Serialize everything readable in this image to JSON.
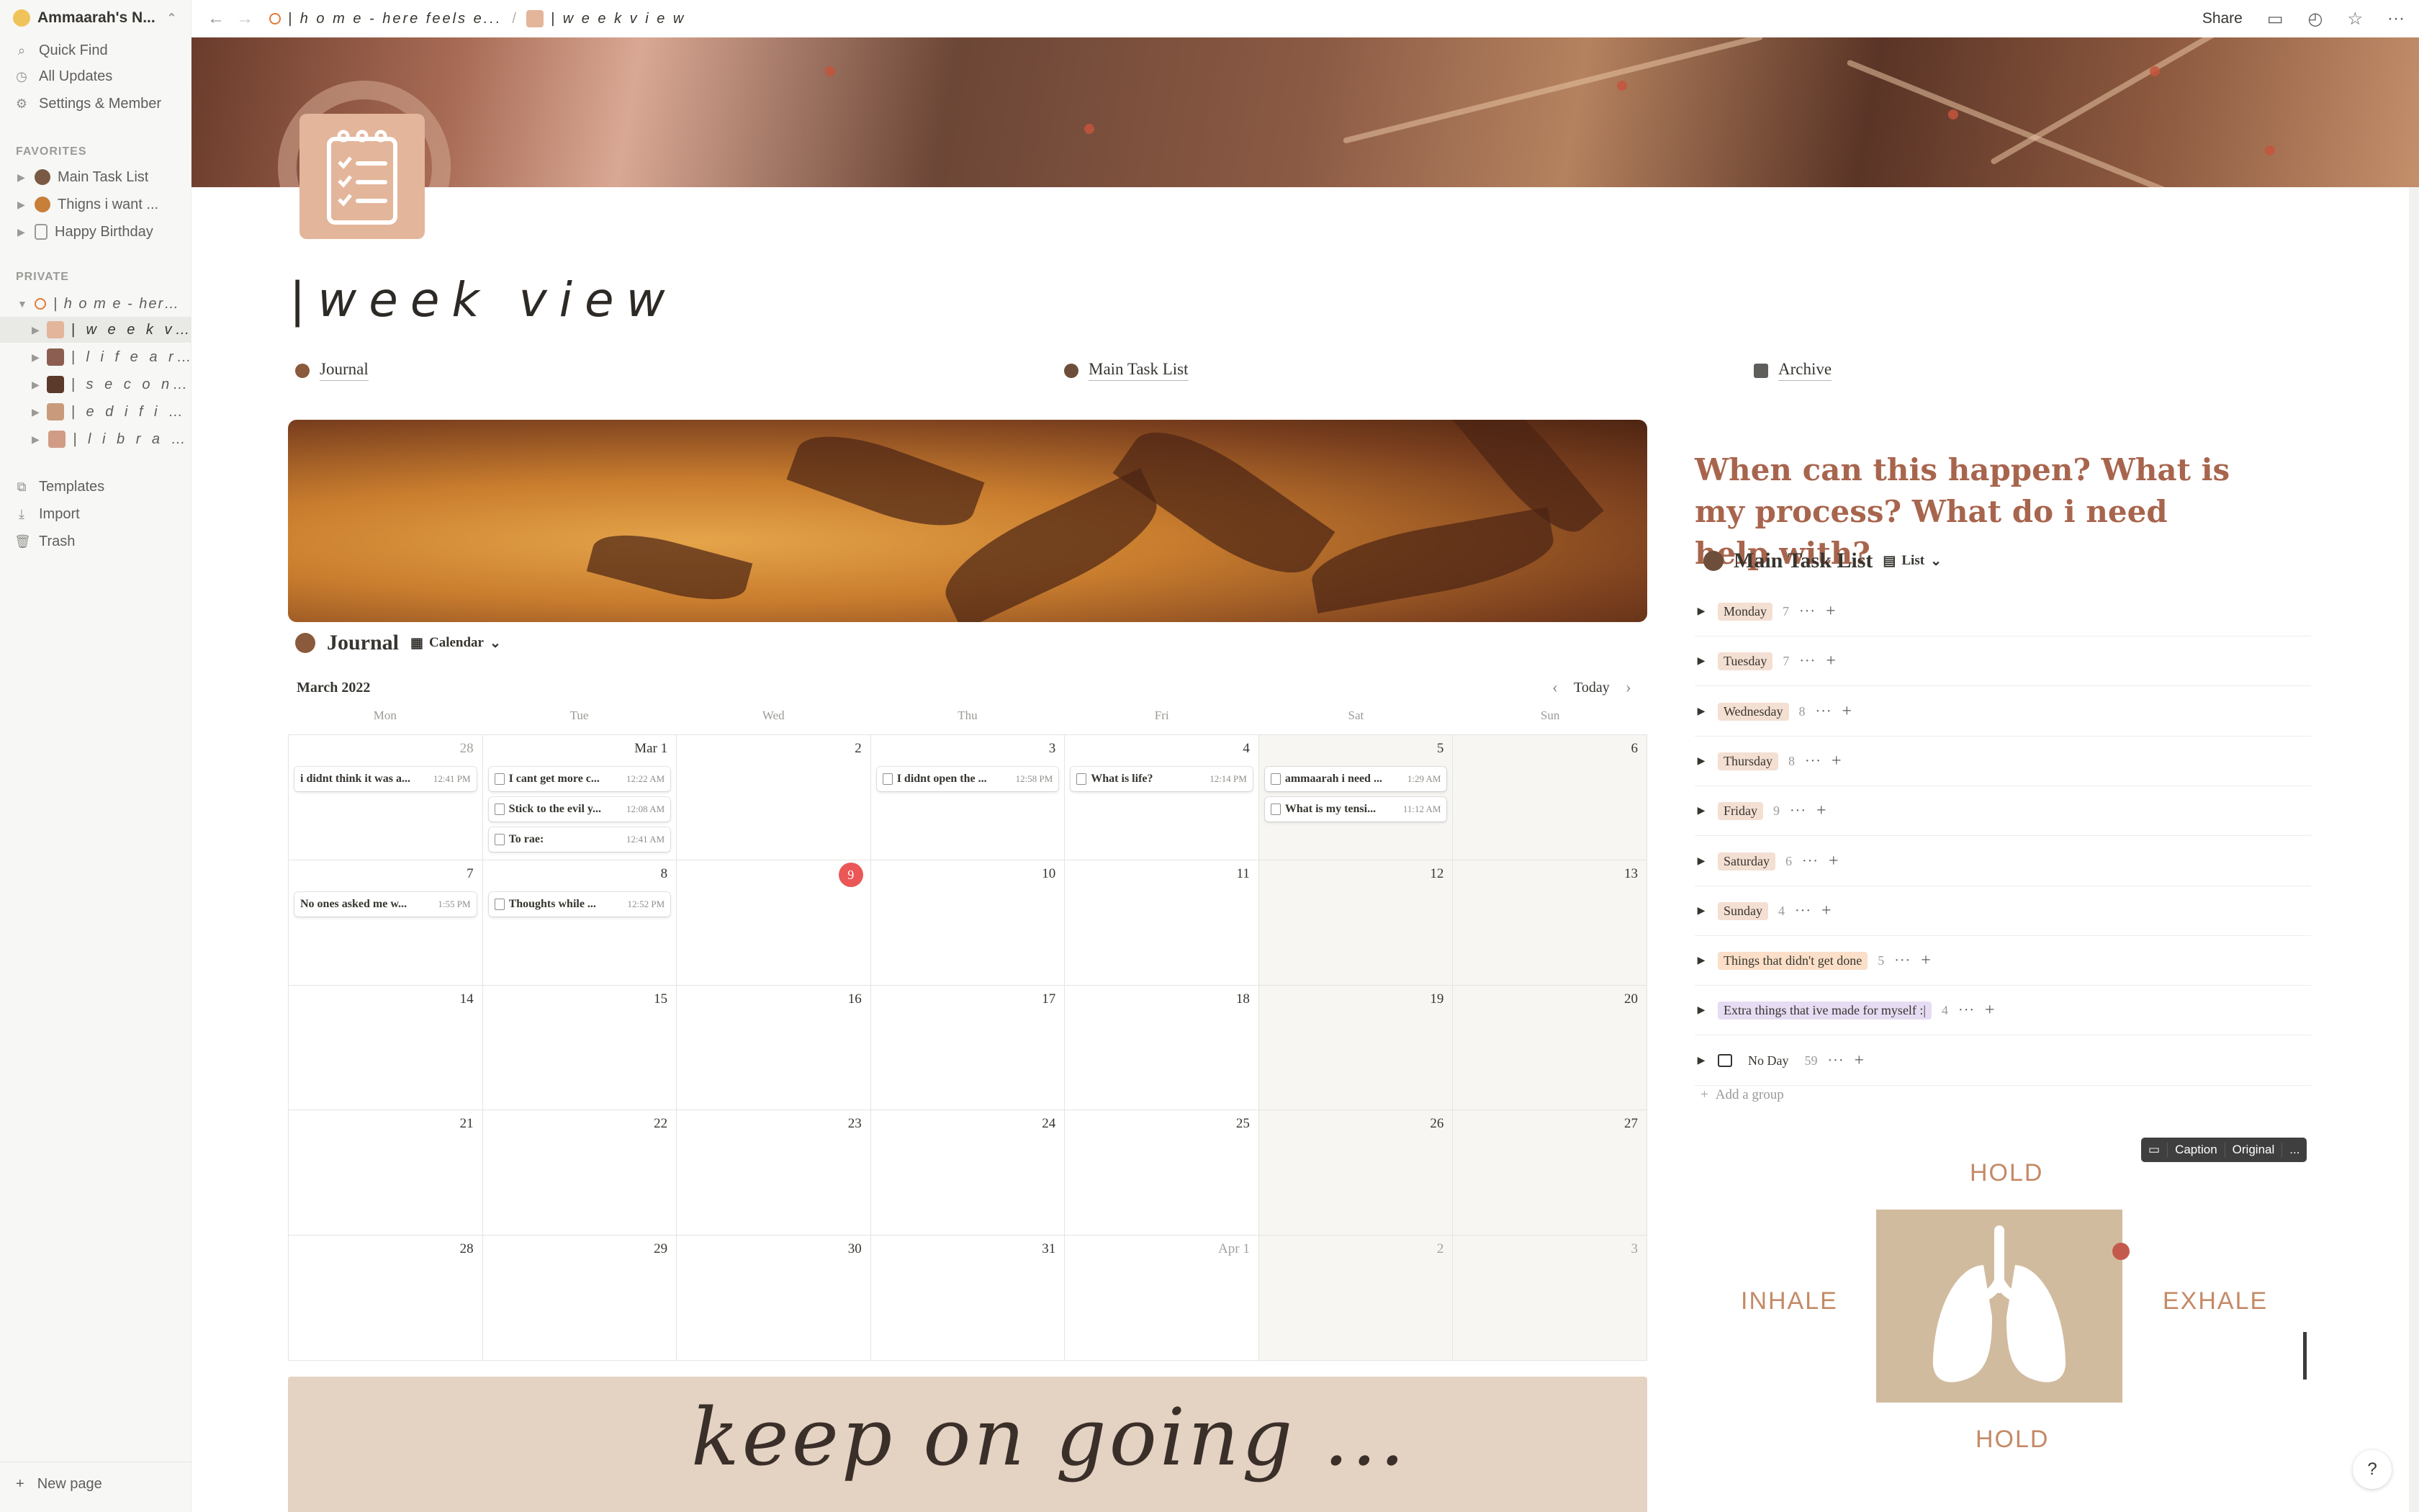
{
  "sidebar": {
    "workspace": "Ammaarah's N...",
    "quick_find": "Quick Find",
    "all_updates": "All Updates",
    "settings": "Settings & Member",
    "favorites_header": "FAVORITES",
    "favorites": [
      {
        "label": "Main Task List",
        "icon": "hedgehog-icon"
      },
      {
        "label": "Thigns i want ...",
        "icon": "snail-icon"
      },
      {
        "label": "Happy Birthday",
        "icon": "document-icon"
      }
    ],
    "private_header": "PRIVATE",
    "home_page": "| h o m e - here...",
    "pages": [
      {
        "label": "| w e e k v i e w",
        "color": "#e3b59a",
        "active": true
      },
      {
        "label": "| l i f e a r e a s",
        "color": "#8c5e52"
      },
      {
        "label": "| s e c o n d b ...",
        "color": "#5b3a2b"
      },
      {
        "label": "| e d i f i c a t...",
        "color": "#c99a7b"
      },
      {
        "label": "| l i b r a r y",
        "color": "#d19c86"
      }
    ],
    "templates": "Templates",
    "import": "Import",
    "trash": "Trash",
    "new_page": "New page"
  },
  "topbar": {
    "crumb_home": "| h o m e - here feels e...",
    "crumb_current": "| w e e k v i e w",
    "share": "Share"
  },
  "page": {
    "title": "|week view",
    "links": [
      {
        "label": "Journal",
        "icon": "bear-icon"
      },
      {
        "label": "Main Task List",
        "icon": "hedgehog-icon"
      },
      {
        "label": "Archive",
        "icon": "inbox-icon"
      }
    ]
  },
  "journal": {
    "title": "Journal",
    "view": "Calendar",
    "month": "March 2022",
    "today": "Today",
    "weekdays": [
      "Mon",
      "Tue",
      "Wed",
      "Thu",
      "Fri",
      "Sat",
      "Sun"
    ],
    "weeks": [
      [
        {
          "day": "28",
          "dim": true,
          "cards": [
            {
              "title": "i didnt think it was a...",
              "time": "12:41 PM",
              "doc": false
            }
          ]
        },
        {
          "day": "Mar 1",
          "cards": [
            {
              "title": "I cant get more c...",
              "time": "12:22 AM",
              "doc": true
            },
            {
              "title": "Stick to the evil y...",
              "time": "12:08 AM",
              "doc": true
            },
            {
              "title": "To rae:",
              "time": "12:41 AM",
              "doc": true
            }
          ]
        },
        {
          "day": "2",
          "cards": []
        },
        {
          "day": "3",
          "cards": [
            {
              "title": "I didnt open the ...",
              "time": "12:58 PM",
              "doc": true
            }
          ]
        },
        {
          "day": "4",
          "cards": [
            {
              "title": "What is life?",
              "time": "12:14 PM",
              "doc": true
            }
          ]
        },
        {
          "day": "5",
          "wkend": true,
          "cards": [
            {
              "title": "ammaarah i need ...",
              "time": "1:29 AM",
              "doc": true
            },
            {
              "title": "What is my tensi...",
              "time": "11:12 AM",
              "doc": true
            }
          ]
        },
        {
          "day": "6",
          "wkend": true,
          "cards": []
        }
      ],
      [
        {
          "day": "7",
          "cards": [
            {
              "title": "No ones asked me w...",
              "time": "1:55 PM",
              "doc": false
            }
          ]
        },
        {
          "day": "8",
          "cards": [
            {
              "title": "Thoughts while ...",
              "time": "12:52 PM",
              "doc": true
            }
          ]
        },
        {
          "day": "9",
          "today": true,
          "cards": []
        },
        {
          "day": "10",
          "cards": []
        },
        {
          "day": "11",
          "cards": []
        },
        {
          "day": "12",
          "wkend": true,
          "cards": []
        },
        {
          "day": "13",
          "wkend": true,
          "cards": []
        }
      ],
      [
        {
          "day": "14",
          "cards": []
        },
        {
          "day": "15",
          "cards": []
        },
        {
          "day": "16",
          "cards": []
        },
        {
          "day": "17",
          "cards": []
        },
        {
          "day": "18",
          "cards": []
        },
        {
          "day": "19",
          "wkend": true,
          "cards": []
        },
        {
          "day": "20",
          "wkend": true,
          "cards": []
        }
      ],
      [
        {
          "day": "21",
          "cards": []
        },
        {
          "day": "22",
          "cards": []
        },
        {
          "day": "23",
          "cards": []
        },
        {
          "day": "24",
          "cards": []
        },
        {
          "day": "25",
          "cards": []
        },
        {
          "day": "26",
          "wkend": true,
          "cards": []
        },
        {
          "day": "27",
          "wkend": true,
          "cards": []
        }
      ],
      [
        {
          "day": "28",
          "cards": []
        },
        {
          "day": "29",
          "cards": []
        },
        {
          "day": "30",
          "cards": []
        },
        {
          "day": "31",
          "cards": []
        },
        {
          "day": "Apr 1",
          "dim": true,
          "cards": []
        },
        {
          "day": "2",
          "dim": true,
          "wkend": true,
          "cards": []
        },
        {
          "day": "3",
          "dim": true,
          "wkend": true,
          "cards": []
        }
      ]
    ]
  },
  "right": {
    "question": "When can this happen? What is my process? What do i need help with?",
    "task_list_title": "Main Task List",
    "task_list_view": "List",
    "groups": [
      {
        "label": "Monday",
        "count": "7",
        "bg": "#f4dfd3"
      },
      {
        "label": "Tuesday",
        "count": "7",
        "bg": "#f4dfd3"
      },
      {
        "label": "Wednesday",
        "count": "8",
        "bg": "#f4dfd3"
      },
      {
        "label": "Thursday",
        "count": "8",
        "bg": "#f4dfd3"
      },
      {
        "label": "Friday",
        "count": "9",
        "bg": "#f4dfd3"
      },
      {
        "label": "Saturday",
        "count": "6",
        "bg": "#f4dfd3"
      },
      {
        "label": "Sunday",
        "count": "4",
        "bg": "#f4dfd3"
      },
      {
        "label": "Things that didn't get done",
        "count": "5",
        "bg": "#fbdfc8"
      },
      {
        "label": "Extra things that ive made for myself :|",
        "count": "4",
        "bg": "#e6dcf3"
      },
      {
        "label": "No Day",
        "count": "59",
        "bg": "transparent",
        "icon": true
      }
    ],
    "add_group": "Add a group",
    "image_toolbar": {
      "caption": "Caption",
      "original": "Original",
      "more": "..."
    },
    "breath": {
      "top": "HOLD",
      "left": "INHALE",
      "right": "EXHALE",
      "bottom": "HOLD"
    }
  },
  "banner": {
    "text": "keep on going ..."
  },
  "colors": {
    "accent": "#a8654d",
    "today": "#eb5757"
  }
}
